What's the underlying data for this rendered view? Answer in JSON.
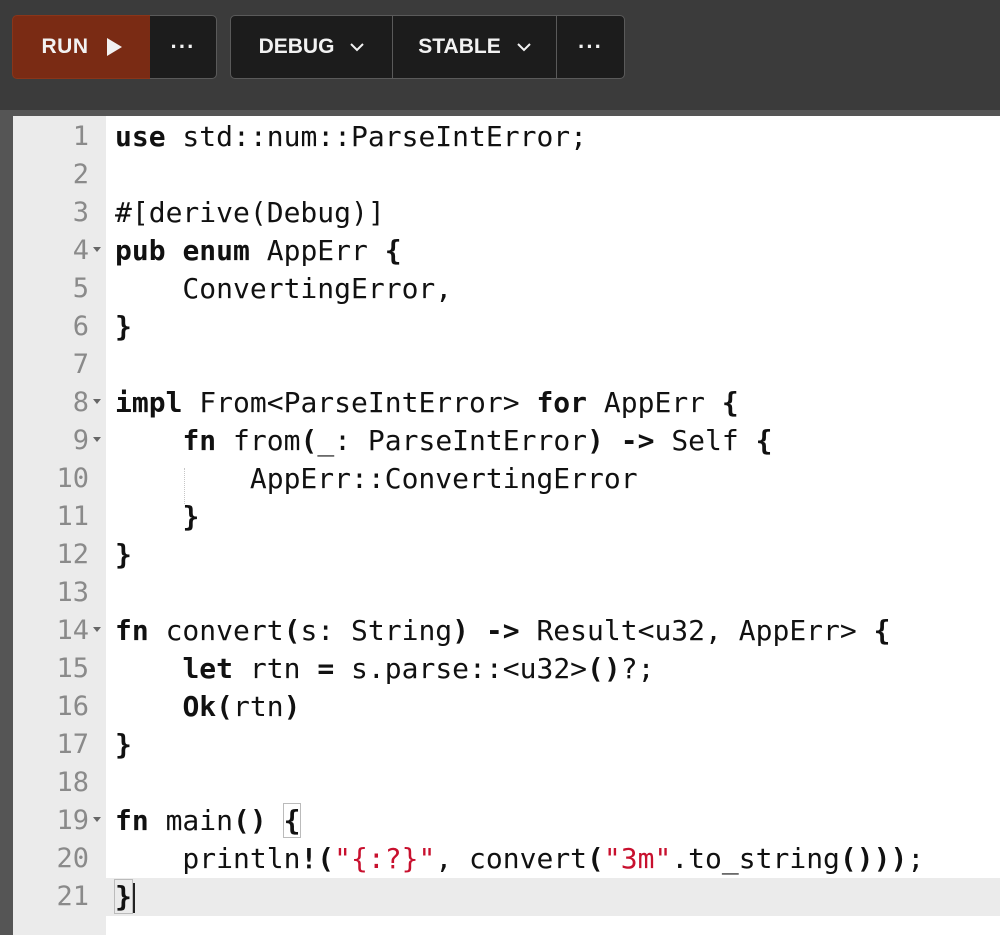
{
  "toolbar": {
    "run_label": "RUN",
    "run_more_label": "···",
    "mode_label": "DEBUG",
    "channel_label": "STABLE",
    "more_label": "···"
  },
  "editor": {
    "line_numbers": [
      "1",
      "2",
      "3",
      "4",
      "5",
      "6",
      "7",
      "8",
      "9",
      "10",
      "11",
      "12",
      "13",
      "14",
      "15",
      "16",
      "17",
      "18",
      "19",
      "20",
      "21"
    ],
    "active_line": 21
  }
}
